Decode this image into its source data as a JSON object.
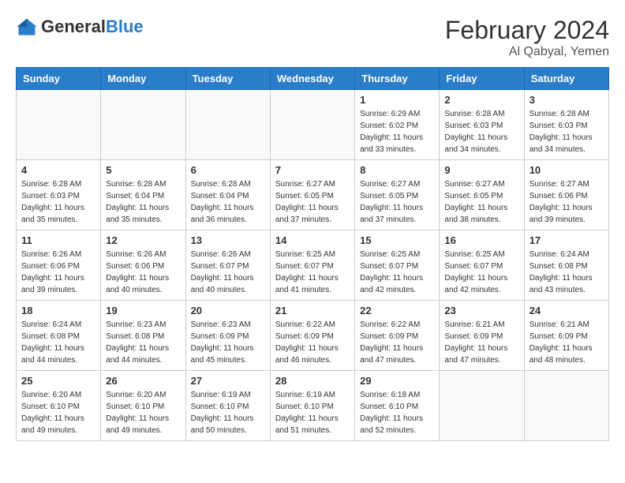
{
  "header": {
    "logo_general": "General",
    "logo_blue": "Blue",
    "month_year": "February 2024",
    "location": "Al Qabyal, Yemen"
  },
  "days_of_week": [
    "Sunday",
    "Monday",
    "Tuesday",
    "Wednesday",
    "Thursday",
    "Friday",
    "Saturday"
  ],
  "weeks": [
    [
      {
        "day": "",
        "info": ""
      },
      {
        "day": "",
        "info": ""
      },
      {
        "day": "",
        "info": ""
      },
      {
        "day": "",
        "info": ""
      },
      {
        "day": "1",
        "info": "Sunrise: 6:29 AM\nSunset: 6:02 PM\nDaylight: 11 hours and 33 minutes."
      },
      {
        "day": "2",
        "info": "Sunrise: 6:28 AM\nSunset: 6:03 PM\nDaylight: 11 hours and 34 minutes."
      },
      {
        "day": "3",
        "info": "Sunrise: 6:28 AM\nSunset: 6:03 PM\nDaylight: 11 hours and 34 minutes."
      }
    ],
    [
      {
        "day": "4",
        "info": "Sunrise: 6:28 AM\nSunset: 6:03 PM\nDaylight: 11 hours and 35 minutes."
      },
      {
        "day": "5",
        "info": "Sunrise: 6:28 AM\nSunset: 6:04 PM\nDaylight: 11 hours and 35 minutes."
      },
      {
        "day": "6",
        "info": "Sunrise: 6:28 AM\nSunset: 6:04 PM\nDaylight: 11 hours and 36 minutes."
      },
      {
        "day": "7",
        "info": "Sunrise: 6:27 AM\nSunset: 6:05 PM\nDaylight: 11 hours and 37 minutes."
      },
      {
        "day": "8",
        "info": "Sunrise: 6:27 AM\nSunset: 6:05 PM\nDaylight: 11 hours and 37 minutes."
      },
      {
        "day": "9",
        "info": "Sunrise: 6:27 AM\nSunset: 6:05 PM\nDaylight: 11 hours and 38 minutes."
      },
      {
        "day": "10",
        "info": "Sunrise: 6:27 AM\nSunset: 6:06 PM\nDaylight: 11 hours and 39 minutes."
      }
    ],
    [
      {
        "day": "11",
        "info": "Sunrise: 6:26 AM\nSunset: 6:06 PM\nDaylight: 11 hours and 39 minutes."
      },
      {
        "day": "12",
        "info": "Sunrise: 6:26 AM\nSunset: 6:06 PM\nDaylight: 11 hours and 40 minutes."
      },
      {
        "day": "13",
        "info": "Sunrise: 6:26 AM\nSunset: 6:07 PM\nDaylight: 11 hours and 40 minutes."
      },
      {
        "day": "14",
        "info": "Sunrise: 6:25 AM\nSunset: 6:07 PM\nDaylight: 11 hours and 41 minutes."
      },
      {
        "day": "15",
        "info": "Sunrise: 6:25 AM\nSunset: 6:07 PM\nDaylight: 11 hours and 42 minutes."
      },
      {
        "day": "16",
        "info": "Sunrise: 6:25 AM\nSunset: 6:07 PM\nDaylight: 11 hours and 42 minutes."
      },
      {
        "day": "17",
        "info": "Sunrise: 6:24 AM\nSunset: 6:08 PM\nDaylight: 11 hours and 43 minutes."
      }
    ],
    [
      {
        "day": "18",
        "info": "Sunrise: 6:24 AM\nSunset: 6:08 PM\nDaylight: 11 hours and 44 minutes."
      },
      {
        "day": "19",
        "info": "Sunrise: 6:23 AM\nSunset: 6:08 PM\nDaylight: 11 hours and 44 minutes."
      },
      {
        "day": "20",
        "info": "Sunrise: 6:23 AM\nSunset: 6:09 PM\nDaylight: 11 hours and 45 minutes."
      },
      {
        "day": "21",
        "info": "Sunrise: 6:22 AM\nSunset: 6:09 PM\nDaylight: 11 hours and 46 minutes."
      },
      {
        "day": "22",
        "info": "Sunrise: 6:22 AM\nSunset: 6:09 PM\nDaylight: 11 hours and 47 minutes."
      },
      {
        "day": "23",
        "info": "Sunrise: 6:21 AM\nSunset: 6:09 PM\nDaylight: 11 hours and 47 minutes."
      },
      {
        "day": "24",
        "info": "Sunrise: 6:21 AM\nSunset: 6:09 PM\nDaylight: 11 hours and 48 minutes."
      }
    ],
    [
      {
        "day": "25",
        "info": "Sunrise: 6:20 AM\nSunset: 6:10 PM\nDaylight: 11 hours and 49 minutes."
      },
      {
        "day": "26",
        "info": "Sunrise: 6:20 AM\nSunset: 6:10 PM\nDaylight: 11 hours and 49 minutes."
      },
      {
        "day": "27",
        "info": "Sunrise: 6:19 AM\nSunset: 6:10 PM\nDaylight: 11 hours and 50 minutes."
      },
      {
        "day": "28",
        "info": "Sunrise: 6:19 AM\nSunset: 6:10 PM\nDaylight: 11 hours and 51 minutes."
      },
      {
        "day": "29",
        "info": "Sunrise: 6:18 AM\nSunset: 6:10 PM\nDaylight: 11 hours and 52 minutes."
      },
      {
        "day": "",
        "info": ""
      },
      {
        "day": "",
        "info": ""
      }
    ]
  ]
}
